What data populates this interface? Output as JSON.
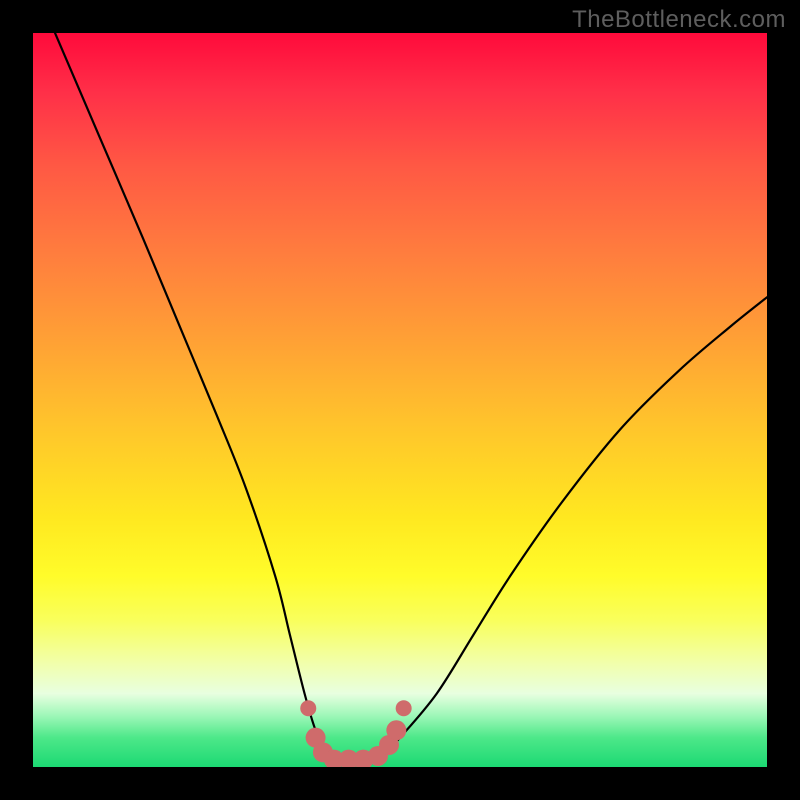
{
  "watermark": "TheBottleneck.com",
  "chart_data": {
    "type": "line",
    "title": "",
    "xlabel": "",
    "ylabel": "",
    "ylim": [
      0,
      100
    ],
    "xlim": [
      0,
      100
    ],
    "series": [
      {
        "name": "bottleneck-curve",
        "x": [
          3,
          9,
          15,
          20,
          25,
          29,
          33,
          35,
          37,
          38.5,
          40,
          42,
          44,
          46,
          48,
          50,
          55,
          60,
          65,
          72,
          80,
          88,
          95,
          100
        ],
        "values": [
          100,
          86,
          72,
          60,
          48,
          38,
          26,
          18,
          10,
          5,
          2,
          1,
          1,
          1,
          2,
          4,
          10,
          18,
          26,
          36,
          46,
          54,
          60,
          64
        ]
      }
    ],
    "markers": {
      "name": "highlight-dots",
      "color": "#cf6b6b",
      "points": [
        {
          "x": 37.5,
          "y": 8
        },
        {
          "x": 38.5,
          "y": 4
        },
        {
          "x": 39.5,
          "y": 2
        },
        {
          "x": 41.0,
          "y": 1
        },
        {
          "x": 43.0,
          "y": 1
        },
        {
          "x": 45.0,
          "y": 1
        },
        {
          "x": 47.0,
          "y": 1.5
        },
        {
          "x": 48.5,
          "y": 3
        },
        {
          "x": 49.5,
          "y": 5
        },
        {
          "x": 50.5,
          "y": 8
        }
      ]
    },
    "gradient_stops": [
      {
        "pos": 0,
        "color": "#ff0a3b"
      },
      {
        "pos": 18,
        "color": "#ff5844"
      },
      {
        "pos": 42,
        "color": "#ffa135"
      },
      {
        "pos": 66,
        "color": "#ffe820"
      },
      {
        "pos": 86,
        "color": "#f1ffad"
      },
      {
        "pos": 100,
        "color": "#1cd973"
      }
    ]
  }
}
